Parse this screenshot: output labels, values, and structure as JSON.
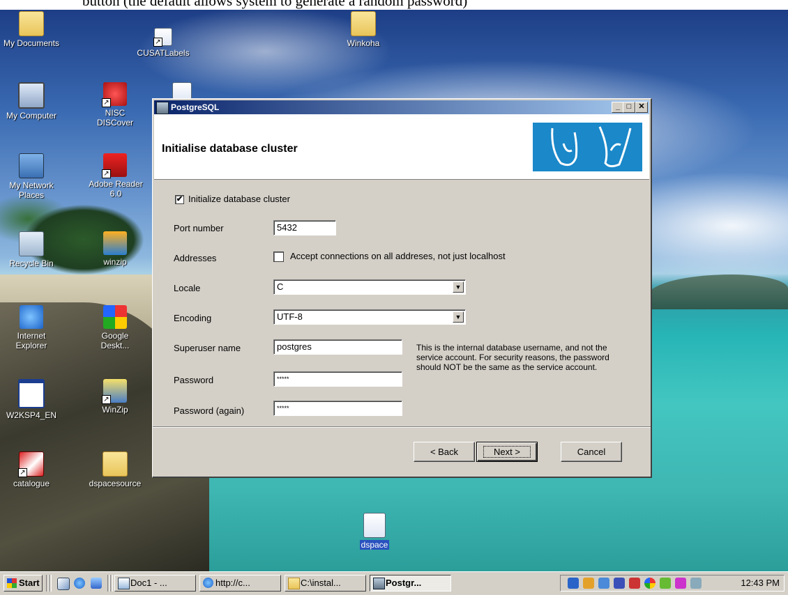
{
  "top_caption": "button (the default allows system to generate a random password)",
  "desktop_icons": [
    {
      "label": "My Documents"
    },
    {
      "label": "CUSATLabels"
    },
    {
      "label": "Winkoha"
    },
    {
      "label": "My Computer"
    },
    {
      "label": "NISC DISCover"
    },
    {
      "label": "My Network Places"
    },
    {
      "label": "Adobe Reader 6.0"
    },
    {
      "label": "Recycle Bin"
    },
    {
      "label": "winzip"
    },
    {
      "label": "Internet Explorer"
    },
    {
      "label": "Google Deskt..."
    },
    {
      "label": "W2KSP4_EN"
    },
    {
      "label": "WinZip"
    },
    {
      "label": "catalogue"
    },
    {
      "label": "dspacesource"
    },
    {
      "label": "dspace"
    }
  ],
  "dialog": {
    "window_title": "PostgreSQL",
    "header_title": "Initialise database cluster",
    "title_buttons": {
      "minimize": "_",
      "maximize": "□",
      "close": "✕"
    },
    "init_checkbox": {
      "label": "Initialize database cluster",
      "checked": true
    },
    "port": {
      "label": "Port number",
      "value": "5432"
    },
    "addresses": {
      "label": "Addresses",
      "checkbox_label": "Accept connections on all addreses, not just localhost",
      "checked": false
    },
    "locale": {
      "label": "Locale",
      "value": "C"
    },
    "encoding": {
      "label": "Encoding",
      "value": "UTF-8"
    },
    "superuser": {
      "label": "Superuser name",
      "value": "postgres"
    },
    "password": {
      "label": "Password",
      "value": "*****"
    },
    "password_again": {
      "label": "Password (again)",
      "value": "*****"
    },
    "help_text": "This is the internal database username, and not the service account. For security reasons, the password should NOT be the same as the service account.",
    "buttons": {
      "back": "< Back",
      "next": "Next >",
      "cancel": "Cancel"
    }
  },
  "taskbar": {
    "start_label": "Start",
    "tasks": [
      {
        "label": "Doc1 - ..."
      },
      {
        "label": "http://c..."
      },
      {
        "label": "C:\\instal..."
      },
      {
        "label": "Postgr...",
        "active": true
      }
    ],
    "clock": "12:43 PM"
  },
  "colors": {
    "titlebar_start": "#0a246a",
    "titlebar_end": "#a6caf0",
    "dialog_face": "#d4d0c8",
    "logo_blue": "#1a88c9"
  }
}
